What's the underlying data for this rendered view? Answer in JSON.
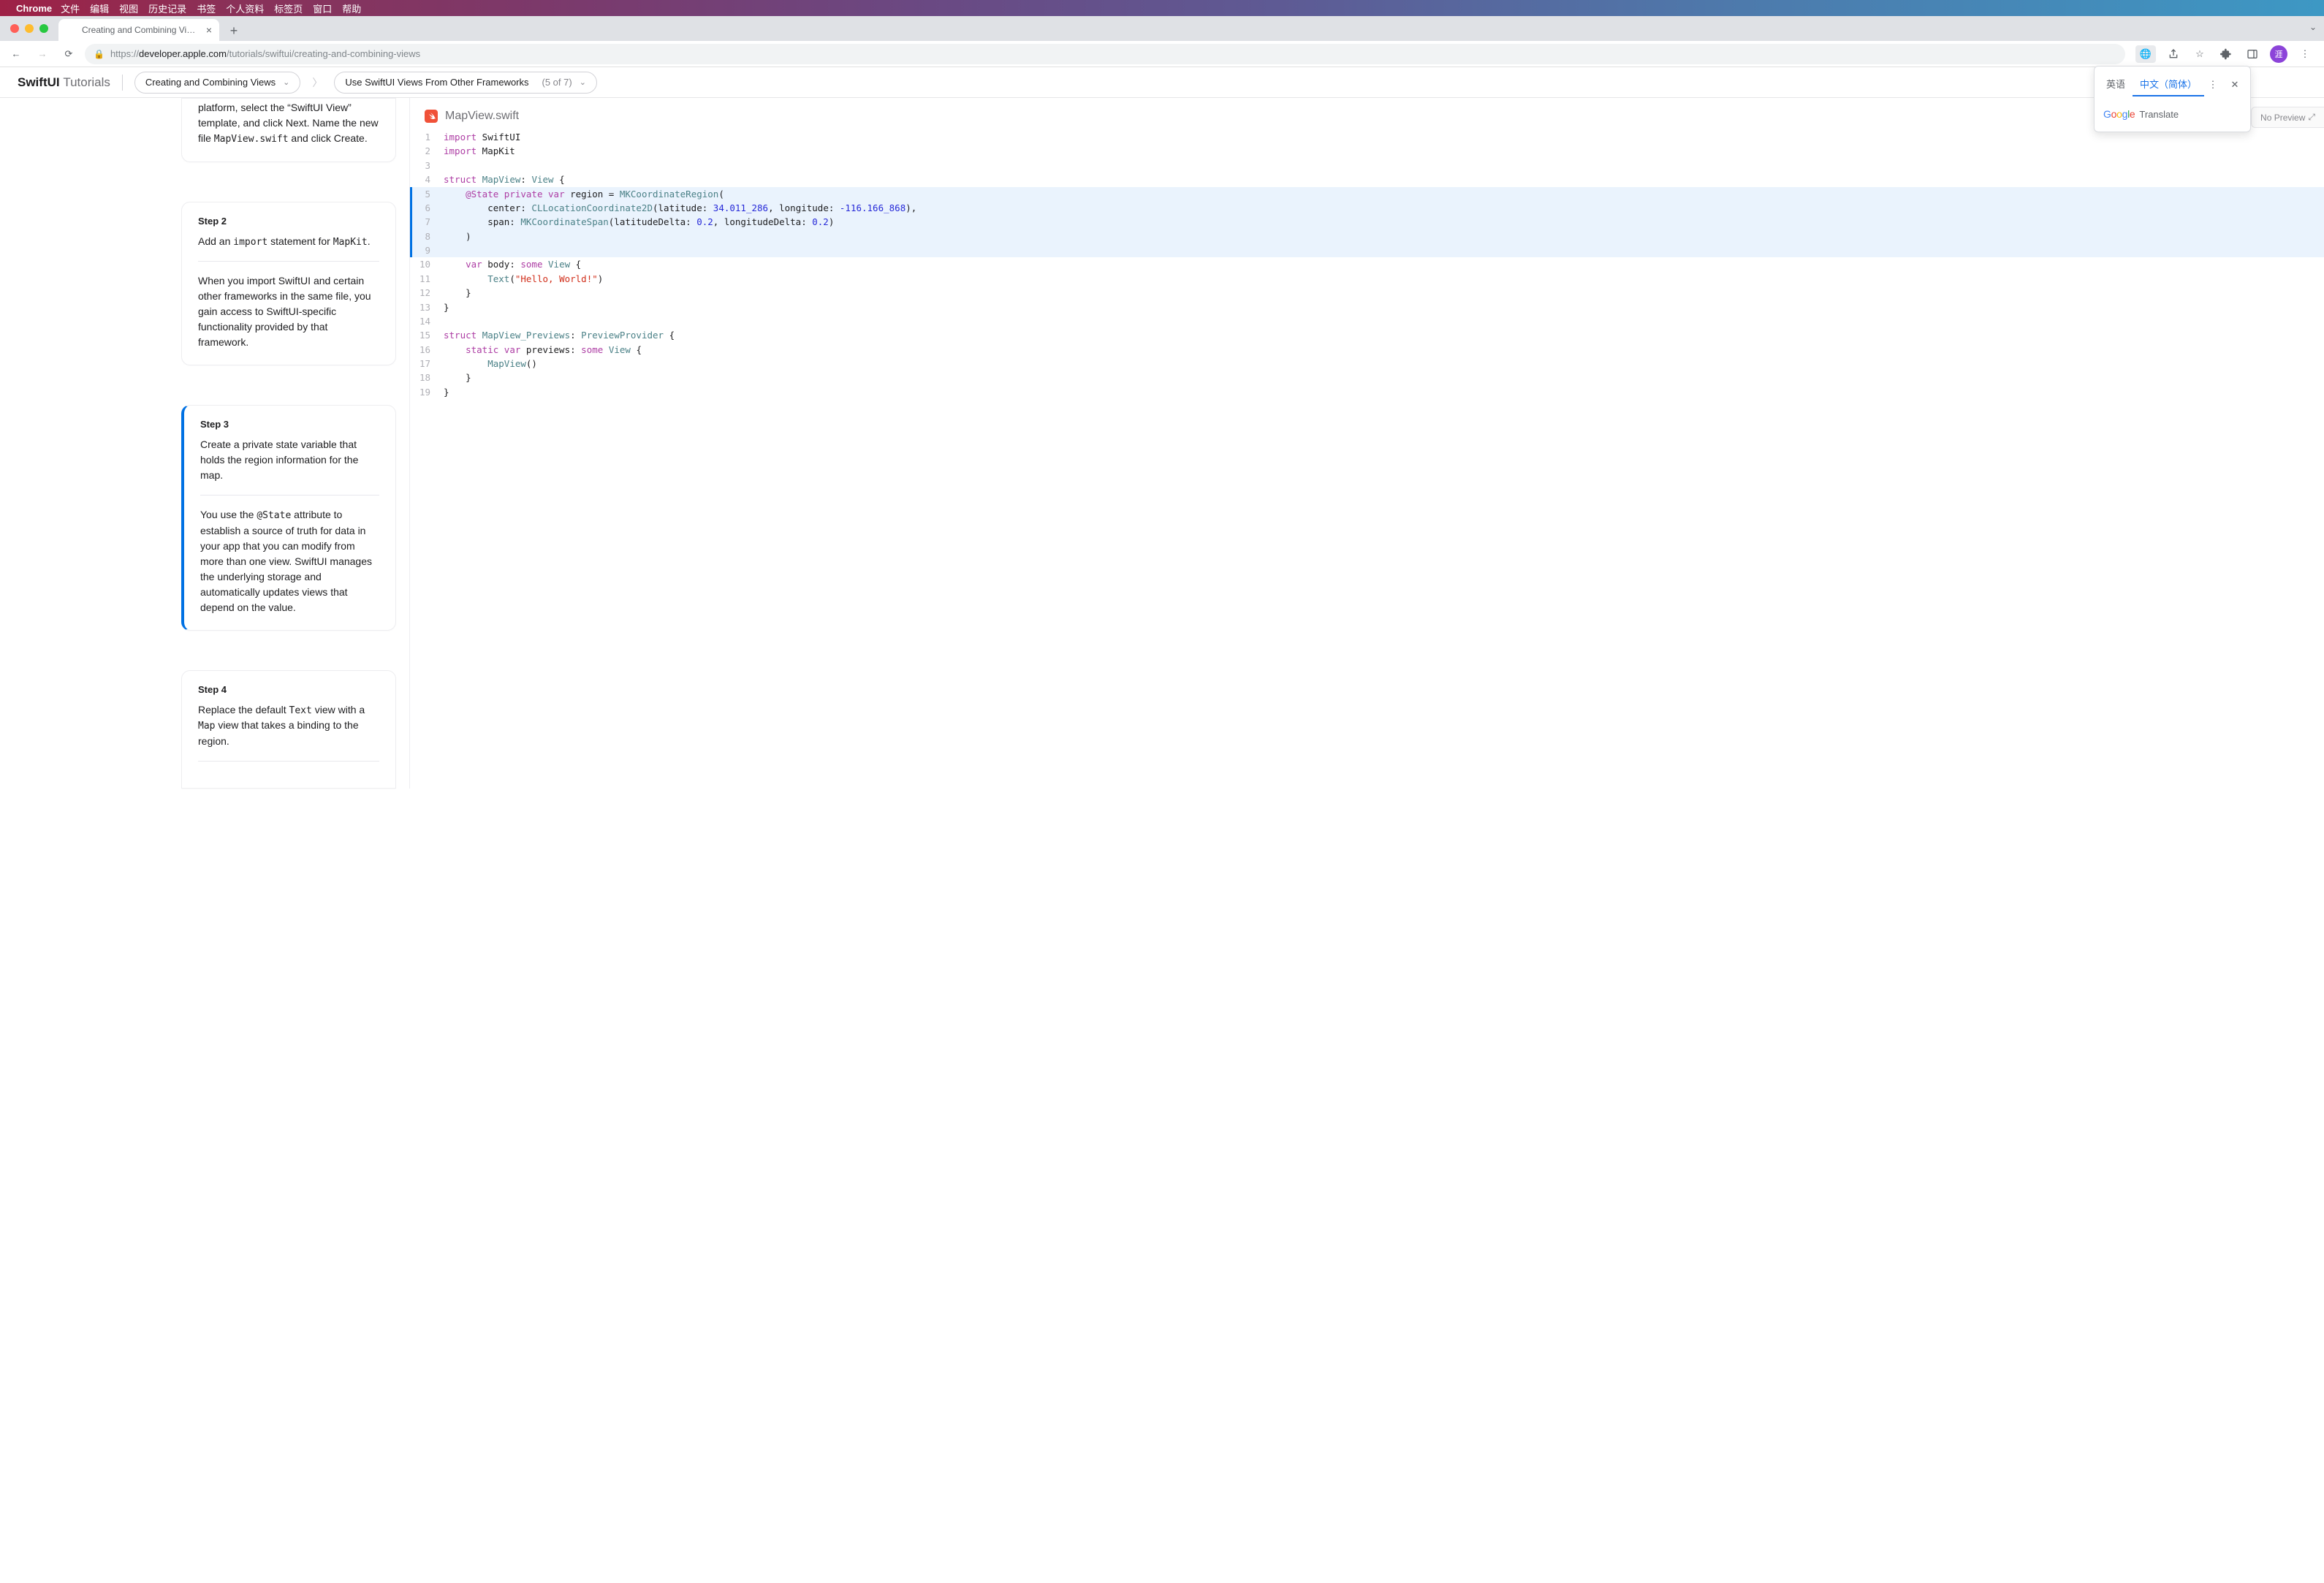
{
  "menubar": {
    "app": "Chrome",
    "items": [
      "文件",
      "编辑",
      "视图",
      "历史记录",
      "书签",
      "个人资料",
      "标签页",
      "窗口",
      "帮助"
    ]
  },
  "browser": {
    "tab_title": "Creating and Combining Views",
    "url_display_prefix": "https://",
    "url_display_host": "developer.apple.com",
    "url_display_path": "/tutorials/swiftui/creating-and-combining-views",
    "avatar_initial": "涯"
  },
  "translate": {
    "tab1": "英语",
    "tab2": "中文（简体）",
    "brand_word": "Translate"
  },
  "page_header": {
    "brand_a": "SwiftUI",
    "brand_b": "Tutorials",
    "crumb1": "Creating and Combining Views",
    "crumb2": "Use SwiftUI Views From Other Frameworks",
    "counter": "(5 of 7)"
  },
  "no_preview": "No Preview",
  "steps": {
    "s1_text_a": "platform, select the “SwiftUI View” template, and click Next. Name the new file ",
    "s1_code1": "MapView.swift",
    "s1_text_b": " and click Create.",
    "s2_title": "Step 2",
    "s2_text_a": "Add an ",
    "s2_code1": "import",
    "s2_text_b": " statement for ",
    "s2_code2": "MapKit",
    "s2_text_c": ".",
    "s2_note": "When you import SwiftUI and certain other frameworks in the same file, you gain access to SwiftUI-specific functionality provided by that framework.",
    "s3_title": "Step 3",
    "s3_body": "Create a private state variable that holds the region information for the map.",
    "s3_note_a": "You use the ",
    "s3_code1": "@State",
    "s3_note_b": " attribute to establish a source of truth for data in your app that you can modify from more than one view. SwiftUI manages the underlying storage and automatically updates views that depend on the value.",
    "s4_title": "Step 4",
    "s4_text_a": "Replace the default ",
    "s4_code1": "Text",
    "s4_text_b": " view with a ",
    "s4_code2": "Map",
    "s4_text_c": " view that takes a binding to the region."
  },
  "code_file": "MapView.swift",
  "code_lines": [
    {
      "n": 1,
      "hl": false,
      "html": "<span class='kw'>import</span> SwiftUI"
    },
    {
      "n": 2,
      "hl": false,
      "html": "<span class='kw'>import</span> MapKit"
    },
    {
      "n": 3,
      "hl": false,
      "html": ""
    },
    {
      "n": 4,
      "hl": false,
      "html": "<span class='kw'>struct</span> <span class='type'>MapView</span>: <span class='type'>View</span> {"
    },
    {
      "n": 5,
      "hl": true,
      "html": "    <span class='kw'>@State</span> <span class='kw'>private</span> <span class='kw'>var</span> region = <span class='type'>MKCoordinateRegion</span>("
    },
    {
      "n": 6,
      "hl": true,
      "html": "        center: <span class='type'>CLLocationCoordinate2D</span>(latitude: <span class='num'>34.011_286</span>, longitude: <span class='num'>-116.166_868</span>),"
    },
    {
      "n": 7,
      "hl": true,
      "html": "        span: <span class='type'>MKCoordinateSpan</span>(latitudeDelta: <span class='num'>0.2</span>, longitudeDelta: <span class='num'>0.2</span>)"
    },
    {
      "n": 8,
      "hl": true,
      "html": "    )"
    },
    {
      "n": 9,
      "hl": true,
      "html": ""
    },
    {
      "n": 10,
      "hl": false,
      "html": "    <span class='kw'>var</span> body: <span class='kw'>some</span> <span class='type'>View</span> {"
    },
    {
      "n": 11,
      "hl": false,
      "html": "        <span class='type'>Text</span>(<span class='str'>\"Hello, World!\"</span>)"
    },
    {
      "n": 12,
      "hl": false,
      "html": "    }"
    },
    {
      "n": 13,
      "hl": false,
      "html": "}"
    },
    {
      "n": 14,
      "hl": false,
      "html": ""
    },
    {
      "n": 15,
      "hl": false,
      "html": "<span class='kw'>struct</span> <span class='type'>MapView_Previews</span>: <span class='type'>PreviewProvider</span> {"
    },
    {
      "n": 16,
      "hl": false,
      "html": "    <span class='kw'>static</span> <span class='kw'>var</span> previews: <span class='kw'>some</span> <span class='type'>View</span> {"
    },
    {
      "n": 17,
      "hl": false,
      "html": "        <span class='type'>MapView</span>()"
    },
    {
      "n": 18,
      "hl": false,
      "html": "    }"
    },
    {
      "n": 19,
      "hl": false,
      "html": "}"
    }
  ]
}
